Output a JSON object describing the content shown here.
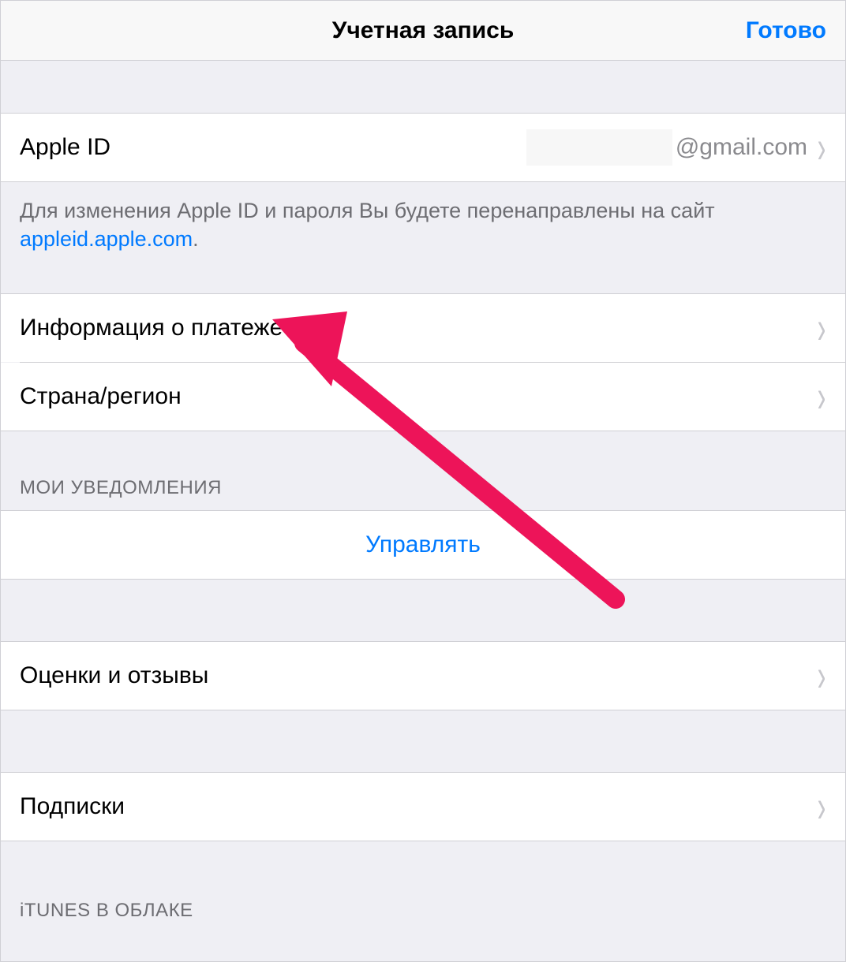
{
  "header": {
    "title": "Учетная запись",
    "done": "Готово"
  },
  "sections": {
    "apple_id": {
      "label": "Apple ID",
      "value_suffix": "@gmail.com",
      "footer_text_prefix": "Для изменения Apple ID и пароля Вы будете перенаправлены на сайт ",
      "footer_link": "appleid.apple.com",
      "footer_text_suffix": "."
    },
    "payment_info": {
      "label": "Информация о платеже"
    },
    "country_region": {
      "label": "Страна/регион"
    },
    "notifications_header": "МОИ УВЕДОМЛЕНИЯ",
    "manage": {
      "label": "Управлять"
    },
    "ratings_reviews": {
      "label": "Оценки и отзывы"
    },
    "subscriptions": {
      "label": "Подписки"
    },
    "itunes_cloud_header": "iTUNES В ОБЛАКЕ"
  },
  "annotation": {
    "arrow_color": "#ed1459"
  }
}
